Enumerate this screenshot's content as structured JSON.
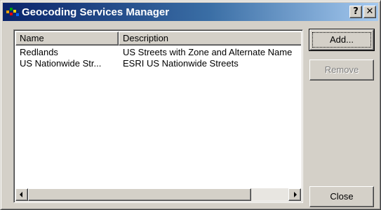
{
  "window": {
    "title": "Geocoding Services Manager",
    "help_label": "?",
    "close_label": "✕",
    "titlebar_colors": [
      "#0a246a",
      "#a6caf0"
    ]
  },
  "list": {
    "columns": [
      {
        "label": "Name"
      },
      {
        "label": "Description"
      }
    ],
    "rows": [
      {
        "name": "Redlands",
        "description": "US Streets with Zone and Alternate Name"
      },
      {
        "name": "US Nationwide Str...",
        "description": "ESRI US Nationwide Streets"
      }
    ]
  },
  "buttons": {
    "add": "Add...",
    "remove": "Remove",
    "close": "Close"
  }
}
